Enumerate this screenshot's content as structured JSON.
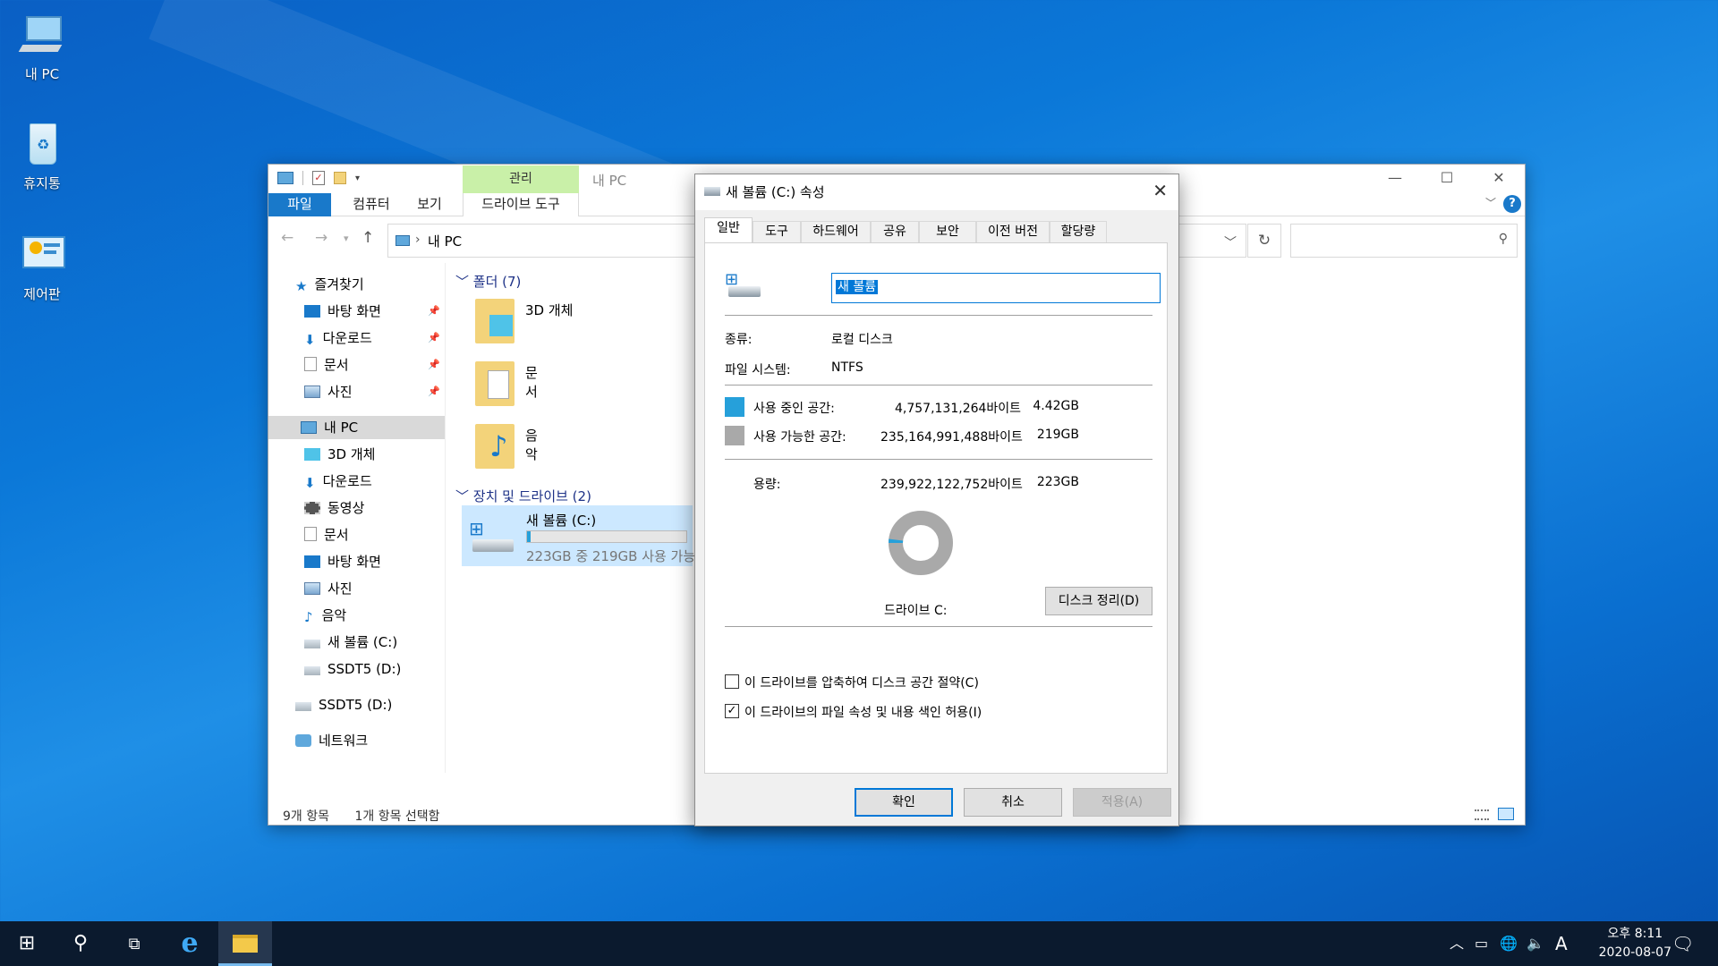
{
  "desktop": {
    "icons": [
      {
        "label": "내 PC"
      },
      {
        "label": "휴지통"
      },
      {
        "label": "제어판"
      }
    ]
  },
  "explorer": {
    "title": "내 PC",
    "manage_tab": "관리",
    "ribbon_tabs": [
      "파일",
      "컴퓨터",
      "보기",
      "드라이브 도구"
    ],
    "address": "내 PC",
    "nav": {
      "quick_access": "즐겨찾기",
      "quick_items": [
        "바탕 화면",
        "다운로드",
        "문서",
        "사진"
      ],
      "this_pc": "내 PC",
      "pc_items": [
        "3D 개체",
        "다운로드",
        "동영상",
        "문서",
        "바탕 화면",
        "사진",
        "음악",
        "새 볼륨 (C:)",
        "SSDT5 (D:)"
      ],
      "ssd": "SSDT5 (D:)",
      "network": "네트워크"
    },
    "folders_header": "폴더 (7)",
    "folders": [
      "3D 개체",
      "문서",
      "음악"
    ],
    "devices_header": "장치 및 드라이브 (2)",
    "drive": {
      "name": "새 볼륨 (C:)",
      "free_text": "223GB 중 219GB 사용 가능",
      "used_fraction": 0.02
    },
    "status": {
      "items": "9개 항목",
      "selected": "1개 항목 선택함"
    }
  },
  "dialog": {
    "title": "새 볼륨 (C:) 속성",
    "tabs": [
      "일반",
      "도구",
      "하드웨어",
      "공유",
      "보안",
      "이전 버전",
      "할당량"
    ],
    "volume_name": "새 볼륨",
    "type_label": "종류:",
    "type_value": "로컬 디스크",
    "fs_label": "파일 시스템:",
    "fs_value": "NTFS",
    "used_label": "사용 중인 공간:",
    "used_bytes": "4,757,131,264바이트",
    "used_gb": "4.42GB",
    "free_label": "사용 가능한 공간:",
    "free_bytes": "235,164,991,488바이트",
    "free_gb": "219GB",
    "cap_label": "용량:",
    "cap_bytes": "239,922,122,752바이트",
    "cap_gb": "223GB",
    "drive_label": "드라이브 C:",
    "cleanup_btn": "디스크 정리(D)",
    "compress_label": "이 드라이브를 압축하여 디스크 공간 절약(C)",
    "index_label": "이 드라이브의 파일 속성 및 내용 색인 허용(I)",
    "ok": "확인",
    "cancel": "취소",
    "apply": "적용(A)",
    "used_fraction": 0.0198,
    "colors": {
      "used": "#26a0da",
      "free": "#a9a9a9"
    }
  },
  "taskbar": {
    "time": "오후 8:11",
    "date": "2020-08-07",
    "ime": "A"
  }
}
